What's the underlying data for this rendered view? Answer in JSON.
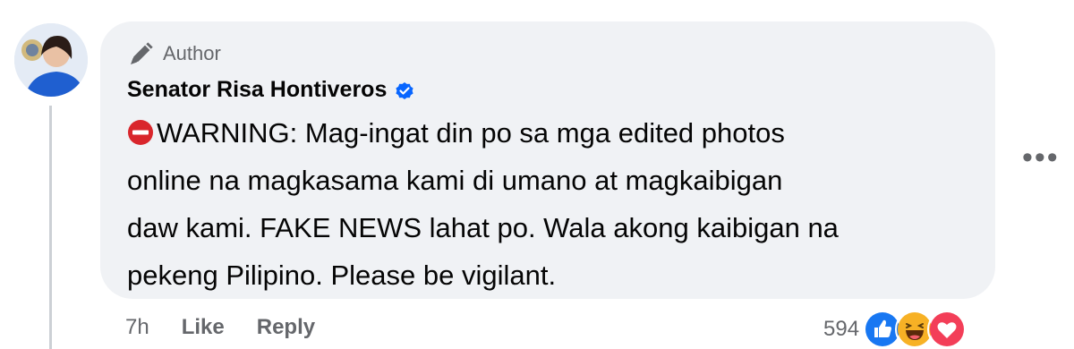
{
  "commenter": {
    "badge_label": "Author",
    "name": "Senator Risa Hontiveros",
    "verified": true,
    "avatar_icon": "profile-photo"
  },
  "comment": {
    "lead_icon": "no-entry-icon",
    "lines": [
      "WARNING: Mag-ingat din po sa mga edited photos",
      "online na magkasama kami di umano at magkaibigan",
      "daw kami. FAKE NEWS lahat po. Wala akong kaibigan na",
      "pekeng Pilipino. Please be vigilant."
    ]
  },
  "footer": {
    "time": "7h",
    "like_label": "Like",
    "reply_label": "Reply",
    "reaction_count": "594",
    "reaction_icons": [
      "like-reaction-icon",
      "haha-reaction-icon",
      "love-reaction-icon"
    ]
  },
  "more_label": "•••",
  "colors": {
    "bubble": "#f0f2f5",
    "secondary_text": "#65676b",
    "verified_blue": "#0866ff",
    "like_blue": "#1877f2",
    "love_red": "#f33e58",
    "haha_yellow": "#f7b125"
  }
}
